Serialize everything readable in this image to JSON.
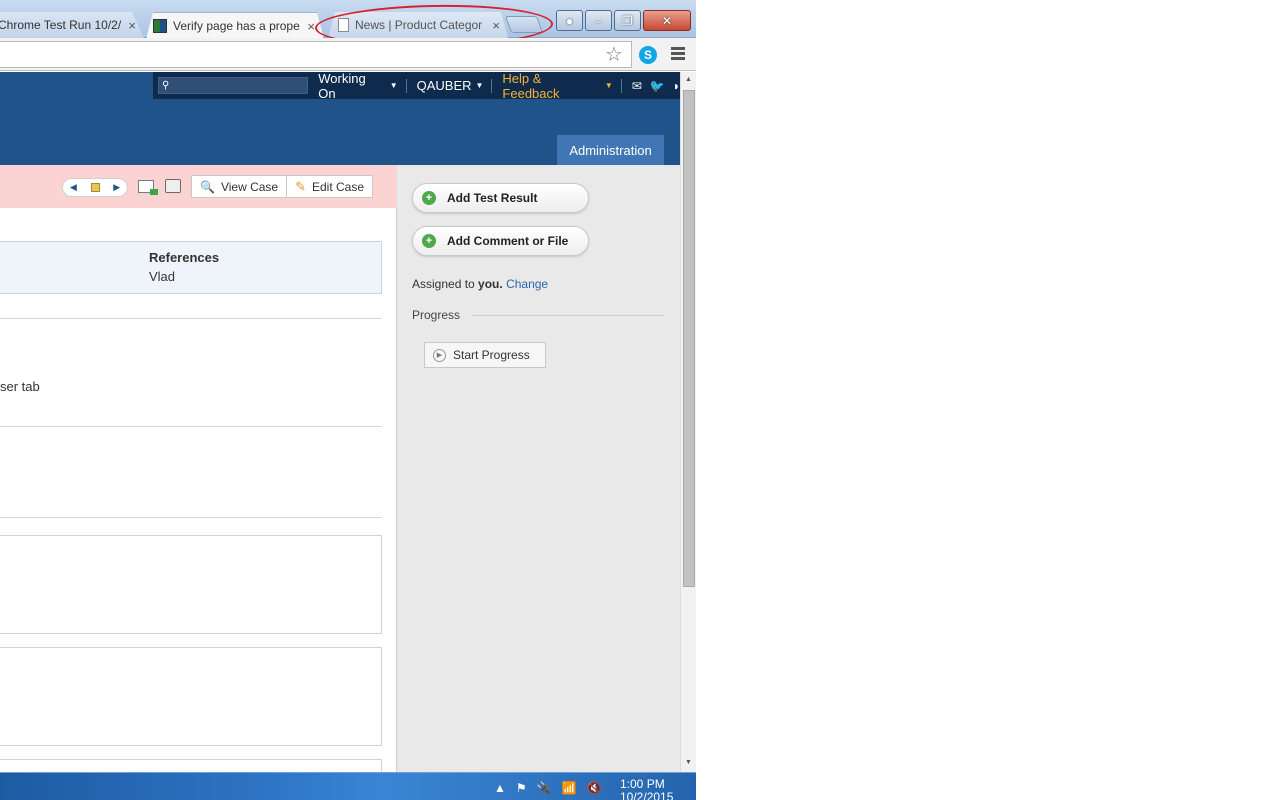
{
  "tabs": [
    {
      "title": "Chrome Test Run 10/2/",
      "active": false
    },
    {
      "title": "Verify page has a prope",
      "active": true
    },
    {
      "title": "News | Product Categor",
      "active": false
    }
  ],
  "tab_close_glyph": "×",
  "window": {
    "min_glyph": "–",
    "max_glyph": "❐",
    "close_glyph": "✕",
    "user_glyph": "●"
  },
  "toolbar": {
    "star_glyph": "☆",
    "skype_glyph": "S"
  },
  "topbar": {
    "search_placeholder": "",
    "working_on": "Working On",
    "user": "QAUBER",
    "help": "Help & Feedback",
    "caret": "▼",
    "icons": [
      "mail-icon",
      "twitter-icon",
      "rss-icon"
    ],
    "icon_glyphs": [
      "✉",
      "🐦",
      "◗"
    ]
  },
  "nav": {
    "admin": "Administration"
  },
  "case_toolbar": {
    "prev_glyph": "◀",
    "next_glyph": "▶",
    "view_case": "View Case",
    "edit_case": "Edit Case",
    "view_glyph": "🔍",
    "edit_glyph": "✎"
  },
  "details": {
    "references_label": "References",
    "references_value": "Vlad",
    "step_fragment": "ser tab"
  },
  "sidebar": {
    "add_result": "Add Test Result",
    "add_comment": "Add Comment or File",
    "plus_glyph": "+",
    "assigned_prefix": "Assigned to ",
    "assigned_you": "you.",
    "change": "Change",
    "progress_label": "Progress",
    "start_progress": "Start Progress",
    "play_glyph": "▶"
  },
  "scroll": {
    "up_glyph": "▲",
    "down_glyph": "▼"
  },
  "taskbar": {
    "time": "1:00 PM",
    "date": "10/2/2015",
    "tray_glyphs": [
      "▲",
      "⚑",
      "🔌",
      "📶",
      "🔇"
    ]
  },
  "colors": {
    "header": "#1f5389",
    "topbar": "#0e2a4c",
    "help": "#f6b332",
    "pink": "#fcd3d3",
    "admin_tab": "#3f76b3",
    "annotation": "#d62230"
  }
}
